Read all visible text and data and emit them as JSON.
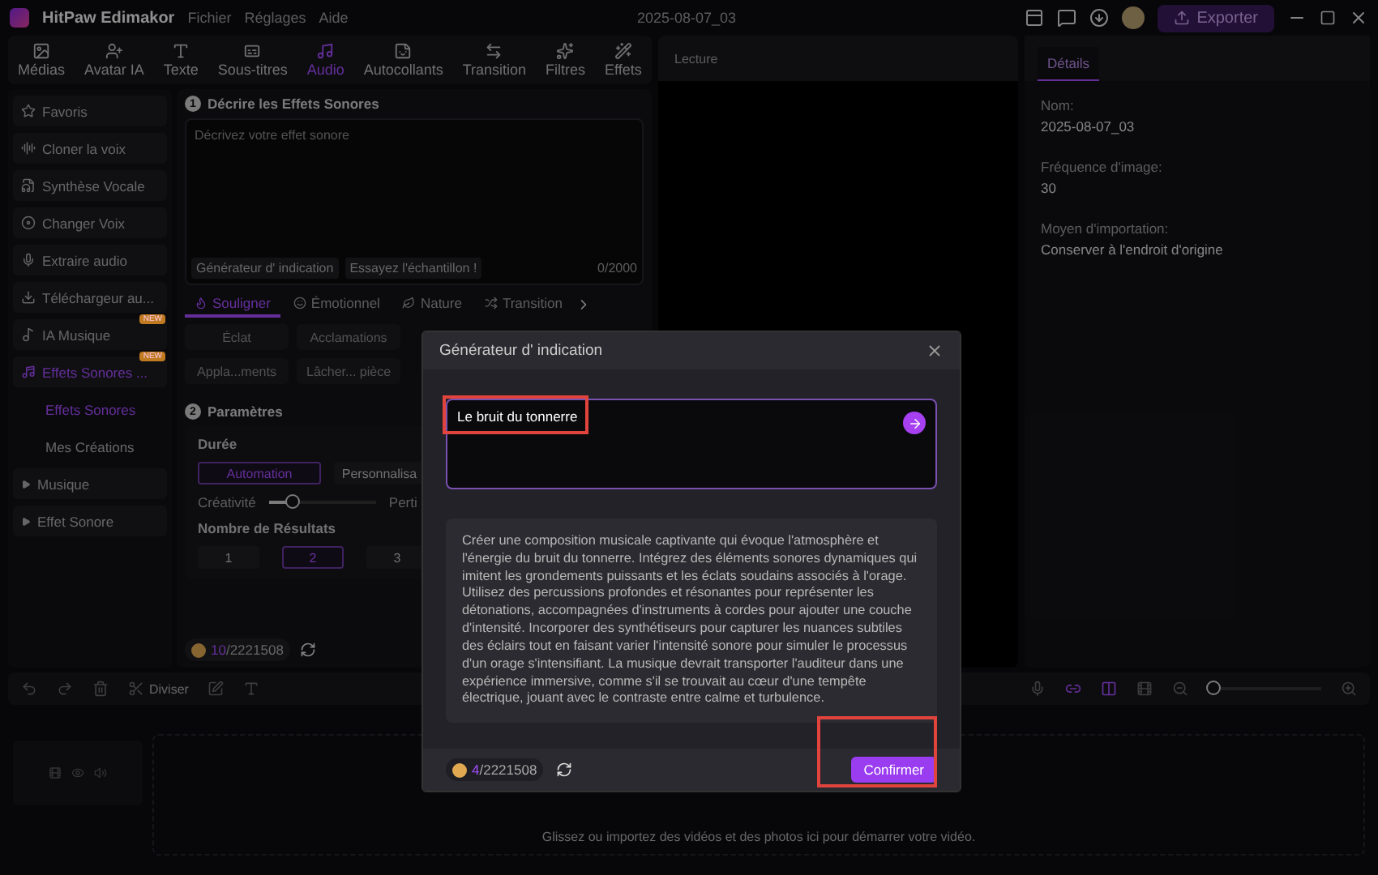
{
  "app": {
    "name": "HitPaw Edimakor",
    "menus": [
      "Fichier",
      "Réglages",
      "Aide"
    ],
    "project": "2025-08-07_03",
    "export": "Exporter"
  },
  "toolbar": [
    {
      "label": "Médias",
      "selected": false
    },
    {
      "label": "Avatar IA",
      "selected": false
    },
    {
      "label": "Texte",
      "selected": false
    },
    {
      "label": "Sous-titres",
      "selected": false
    },
    {
      "label": "Audio",
      "selected": true
    },
    {
      "label": "Autocollants",
      "selected": false
    },
    {
      "label": "Transition",
      "selected": false
    },
    {
      "label": "Filtres",
      "selected": false
    },
    {
      "label": "Effets",
      "selected": false
    }
  ],
  "sidebar": [
    {
      "kind": "tool",
      "label": "Favoris",
      "selected": false
    },
    {
      "kind": "tool",
      "label": "Cloner la voix",
      "selected": false
    },
    {
      "kind": "tool",
      "label": "Synthèse Vocale",
      "selected": false
    },
    {
      "kind": "tool",
      "label": "Changer Voix",
      "selected": false
    },
    {
      "kind": "tool",
      "label": "Extraire audio",
      "selected": false
    },
    {
      "kind": "tool",
      "label": "Téléchargeur au...",
      "selected": false
    },
    {
      "kind": "tool",
      "label": "IA Musique",
      "badge": "NEW",
      "selected": false
    },
    {
      "kind": "tool",
      "label": "Effets Sonores ...",
      "badge": "NEW",
      "selected": true,
      "expanded": true,
      "children": [
        {
          "label": "Effets Sonores",
          "selected": true
        },
        {
          "label": "Mes Créations",
          "selected": false
        }
      ]
    },
    {
      "kind": "folder",
      "label": "Musique",
      "expanded": false
    },
    {
      "kind": "folder",
      "label": "Effet Sonore",
      "expanded": false
    }
  ],
  "describe": {
    "step": "1",
    "title": "Décrire les Effets Sonores",
    "placeholder": "Décrivez votre effet sonore",
    "buttons": [
      "Générateur d'  indication",
      "Essayez l'échantillon !"
    ],
    "counter": "0/2000"
  },
  "categories": [
    {
      "label": "Souligner",
      "selected": true
    },
    {
      "label": "Émotionnel",
      "selected": false
    },
    {
      "label": "Nature",
      "selected": false
    },
    {
      "label": "Transition",
      "selected": false
    }
  ],
  "chips": [
    "Éclat",
    "Acclamations",
    "Appla...ments",
    "Lâcher... pièce"
  ],
  "params": {
    "step": "2",
    "title": "Paramètres",
    "duration_label": "Durée",
    "duration_options": [
      {
        "label": "Automation",
        "selected": true
      },
      {
        "label": "Personnalisa",
        "selected": false
      }
    ],
    "creativity_label": "Créativité",
    "creativity": {
      "level": 0.22
    },
    "relevance_label": "Perti",
    "results_label": "Nombre de Résultats",
    "results": [
      {
        "label": "1",
        "selected": false
      },
      {
        "label": "2",
        "selected": true
      },
      {
        "label": "3",
        "selected": false
      }
    ]
  },
  "credits": {
    "used": "10",
    "rest": "/2221508"
  },
  "preview": {
    "title": "Lecture"
  },
  "details": {
    "tab": "Détails",
    "fields": [
      {
        "label": "Nom:",
        "value": "2025-08-07_03"
      },
      {
        "label": "Fréquence d'image:",
        "value": "30"
      },
      {
        "label": "Moyen d'importation:",
        "value": "Conserver à l'endroit d'origine"
      }
    ]
  },
  "timeline": {
    "split": "Diviser",
    "zoom": {
      "level": 0.04
    },
    "drop_hint": "Glissez ou importez des vidéos et des photos ici pour démarrer votre vidéo."
  },
  "dialog": {
    "title": "Générateur d'  indication",
    "input": {
      "value": "Le bruit du tonnerre",
      "highlighted": true
    },
    "suggestion": "Créer une composition musicale captivante qui évoque l'atmosphère et l'énergie du bruit du tonnerre. Intégrez des éléments sonores dynamiques qui imitent les grondements puissants et les éclats soudains associés à l'orage. Utilisez des percussions profondes et résonantes pour représenter les détonations, accompagnées d'instruments à cordes pour ajouter une couche d'intensité. Incorporer des synthétiseurs pour capturer les nuances subtiles des éclairs tout en faisant varier l'intensité sonore pour simuler le processus d'un orage s'intensifiant. La musique devrait transporter l'auditeur dans une expérience immersive, comme s'il se trouvait au cœur d'une tempête électrique, jouant avec le contraste entre calme et turbulence.",
    "credits": {
      "used": "4",
      "rest": "/2221508"
    },
    "confirm": {
      "label": "Confirmer",
      "highlighted": true
    }
  }
}
